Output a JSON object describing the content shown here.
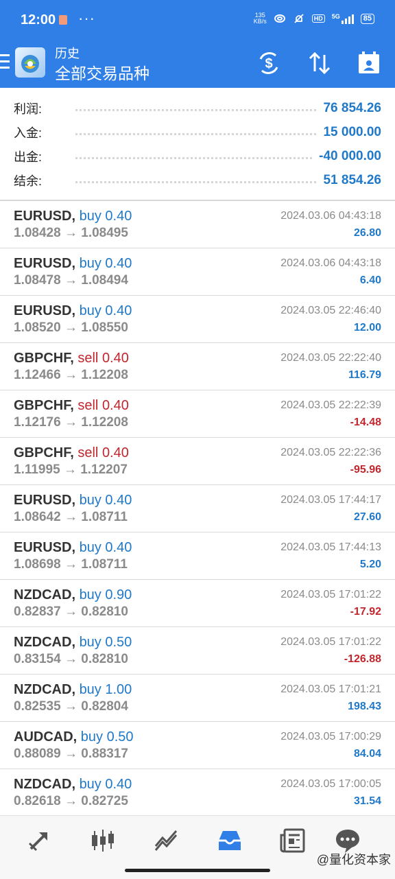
{
  "status_bar": {
    "time": "12:00",
    "more": "···",
    "net_speed_value": "135",
    "net_speed_unit": "KB/s",
    "hd": "HD",
    "network": "5G",
    "battery": "85"
  },
  "header": {
    "title_small": "历史",
    "title_big": "全部交易品种"
  },
  "summary": [
    {
      "label": "利润:",
      "value": "76 854.26"
    },
    {
      "label": "入金:",
      "value": "15 000.00"
    },
    {
      "label": "出金:",
      "value": "-40 000.00"
    },
    {
      "label": "结余:",
      "value": "51 854.26"
    }
  ],
  "trades": [
    {
      "symbol": "EURUSD",
      "side": "buy",
      "volume": "0.40",
      "open": "1.08428",
      "close": "1.08495",
      "time": "2024.03.06 04:43:18",
      "profit": "26.80"
    },
    {
      "symbol": "EURUSD",
      "side": "buy",
      "volume": "0.40",
      "open": "1.08478",
      "close": "1.08494",
      "time": "2024.03.06 04:43:18",
      "profit": "6.40"
    },
    {
      "symbol": "EURUSD",
      "side": "buy",
      "volume": "0.40",
      "open": "1.08520",
      "close": "1.08550",
      "time": "2024.03.05 22:46:40",
      "profit": "12.00"
    },
    {
      "symbol": "GBPCHF",
      "side": "sell",
      "volume": "0.40",
      "open": "1.12466",
      "close": "1.12208",
      "time": "2024.03.05 22:22:40",
      "profit": "116.79"
    },
    {
      "symbol": "GBPCHF",
      "side": "sell",
      "volume": "0.40",
      "open": "1.12176",
      "close": "1.12208",
      "time": "2024.03.05 22:22:39",
      "profit": "-14.48"
    },
    {
      "symbol": "GBPCHF",
      "side": "sell",
      "volume": "0.40",
      "open": "1.11995",
      "close": "1.12207",
      "time": "2024.03.05 22:22:36",
      "profit": "-95.96"
    },
    {
      "symbol": "EURUSD",
      "side": "buy",
      "volume": "0.40",
      "open": "1.08642",
      "close": "1.08711",
      "time": "2024.03.05 17:44:17",
      "profit": "27.60"
    },
    {
      "symbol": "EURUSD",
      "side": "buy",
      "volume": "0.40",
      "open": "1.08698",
      "close": "1.08711",
      "time": "2024.03.05 17:44:13",
      "profit": "5.20"
    },
    {
      "symbol": "NZDCAD",
      "side": "buy",
      "volume": "0.90",
      "open": "0.82837",
      "close": "0.82810",
      "time": "2024.03.05 17:01:22",
      "profit": "-17.92"
    },
    {
      "symbol": "NZDCAD",
      "side": "buy",
      "volume": "0.50",
      "open": "0.83154",
      "close": "0.82810",
      "time": "2024.03.05 17:01:22",
      "profit": "-126.88"
    },
    {
      "symbol": "NZDCAD",
      "side": "buy",
      "volume": "1.00",
      "open": "0.82535",
      "close": "0.82804",
      "time": "2024.03.05 17:01:21",
      "profit": "198.43"
    },
    {
      "symbol": "AUDCAD",
      "side": "buy",
      "volume": "0.50",
      "open": "0.88089",
      "close": "0.88317",
      "time": "2024.03.05 17:00:29",
      "profit": "84.04"
    },
    {
      "symbol": "NZDCAD",
      "side": "buy",
      "volume": "0.40",
      "open": "0.82618",
      "close": "0.82725",
      "time": "2024.03.05 17:00:05",
      "profit": "31.54"
    }
  ],
  "bottom_nav": [
    {
      "icon": "quotes-arrows-icon"
    },
    {
      "icon": "chart-candles-icon"
    },
    {
      "icon": "trade-icon"
    },
    {
      "icon": "history-inbox-icon",
      "active": true
    },
    {
      "icon": "news-icon"
    },
    {
      "icon": "chat-icon"
    }
  ],
  "watermark": "@量化资本家",
  "colors": {
    "header_bg": "#2f7fe6",
    "buy_blue": "#1f78c8",
    "sell_red": "#c0262d",
    "active_tab": "#2f7fe6"
  }
}
